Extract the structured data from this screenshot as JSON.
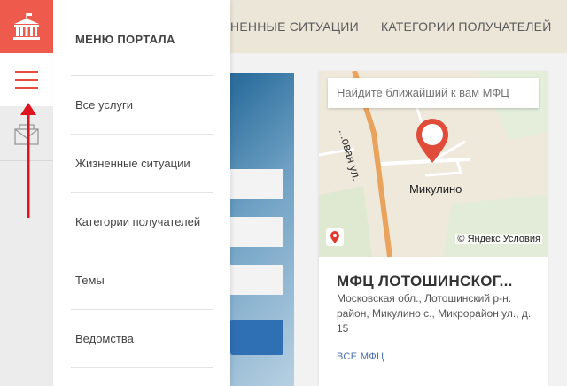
{
  "top_nav": {
    "items": [
      {
        "label": "ЖИЗНЕННЫЕ СИТУАЦИИ"
      },
      {
        "label": "КАТЕГОРИИ ПОЛУЧАТЕЛЕЙ"
      }
    ]
  },
  "side_menu": {
    "title": "МЕНЮ ПОРТАЛА",
    "items": [
      {
        "label": "Все услуги"
      },
      {
        "label": "Жизненные ситуации"
      },
      {
        "label": "Категории получателей"
      },
      {
        "label": "Темы"
      },
      {
        "label": "Ведомства"
      }
    ]
  },
  "rail": {
    "logo_icon": "government-building-icon",
    "burger_icon": "hamburger-menu-icon",
    "mail_icon": "envelope-icon"
  },
  "map_card": {
    "search_placeholder": "Найдите ближайший к вам МФЦ",
    "street_label": "...овая ул.",
    "village_label": "Микулино",
    "copyright": "© Яндекс",
    "terms_link": "Условия",
    "title": "МФЦ ЛОТОШИНСКОГ...",
    "address": "Московская обл., Лотошинский р-н. район, Микулино с., Микрорайон ул., д. 15",
    "all_link": "ВСЕ МФЦ"
  },
  "colors": {
    "accent_red": "#ee5a4c",
    "link_blue": "#4a6fb2",
    "map_pin": "#e04b3a",
    "road_orange": "#e9a35c"
  }
}
